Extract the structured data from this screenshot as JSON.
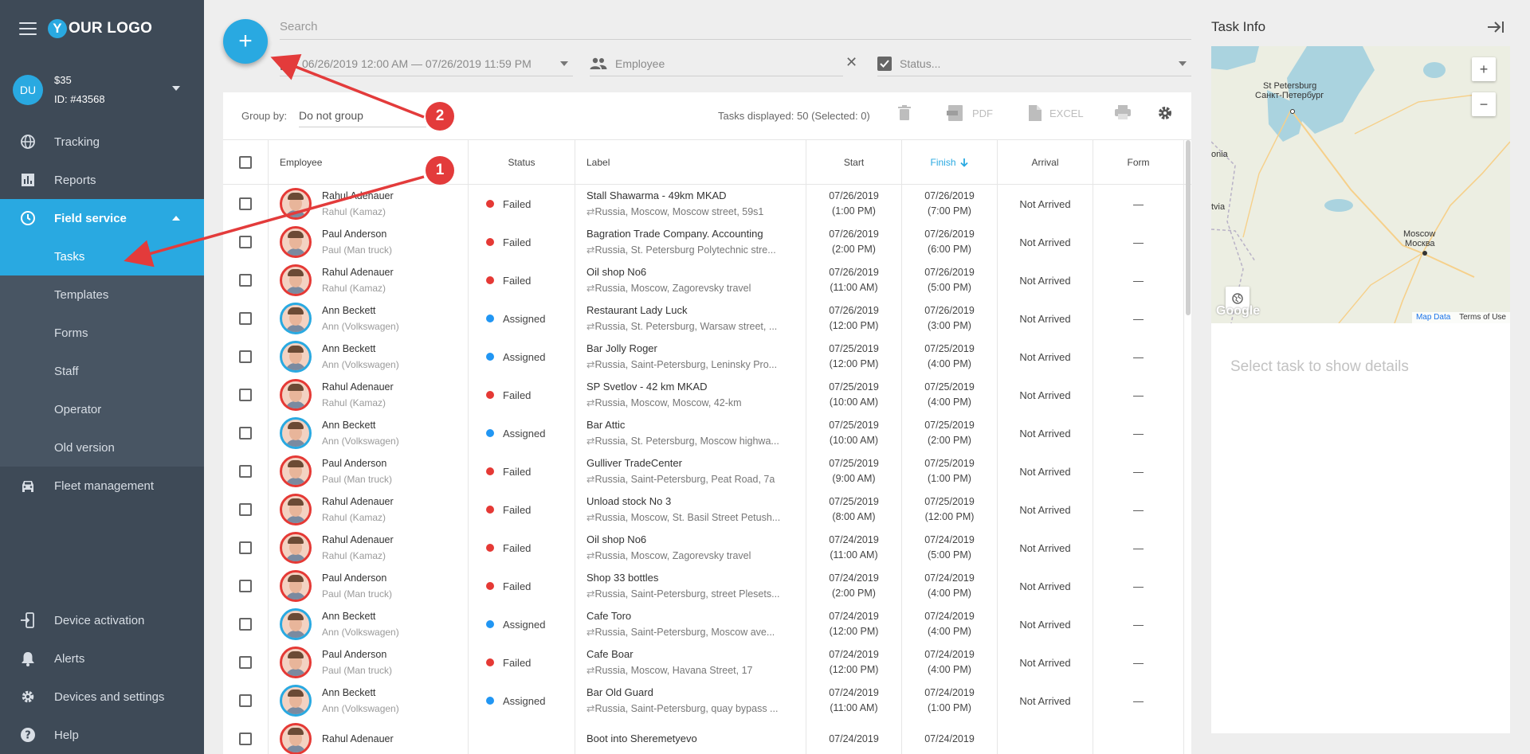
{
  "sidebar": {
    "logo_y": "Y",
    "logo_text": "OUR LOGO",
    "user": {
      "initials": "DU",
      "balance": "$35",
      "id": "ID: #43568"
    },
    "nav_top": [
      {
        "label": "Tracking",
        "icon": "globe-icon"
      },
      {
        "label": "Reports",
        "icon": "bar-chart-icon"
      },
      {
        "label": "Field service",
        "icon": "clock-icon",
        "active": true
      }
    ],
    "subnav": [
      {
        "label": "Tasks",
        "active": true
      },
      {
        "label": "Templates"
      },
      {
        "label": "Forms"
      },
      {
        "label": "Staff"
      },
      {
        "label": "Operator"
      },
      {
        "label": "Old version"
      }
    ],
    "fleet": {
      "label": "Fleet management",
      "icon": "car-icon"
    },
    "nav_bottom": [
      {
        "label": "Device activation",
        "icon": "device-login-icon"
      },
      {
        "label": "Alerts",
        "icon": "bell-icon"
      },
      {
        "label": "Devices and settings",
        "icon": "gear-icon"
      },
      {
        "label": "Help",
        "icon": "help-icon"
      }
    ]
  },
  "toolbar": {
    "fab_label": "+",
    "search_placeholder": "Search",
    "date_range": "06/26/2019 12:00 AM — 07/26/2019 11:59 PM",
    "employee_placeholder": "Employee",
    "clear_label": "✕",
    "status_placeholder": "Status..."
  },
  "table_toolbar": {
    "group_by_label": "Group by:",
    "group_by_value": "Do not group",
    "tasks_count": "Tasks displayed: 50 (Selected: 0)",
    "pdf_label": "PDF",
    "excel_label": "EXCEL"
  },
  "columns": {
    "employee": "Employee",
    "status": "Status",
    "label": "Label",
    "start": "Start",
    "finish": "Finish",
    "arrival": "Arrival",
    "form": "Form"
  },
  "status_colors": {
    "Failed": "#e53935",
    "Assigned": "#2196f3"
  },
  "rows": [
    {
      "name": "Rahul Adenauer",
      "sub": "Rahul (Kamaz)",
      "avatar": "red",
      "status": "Failed",
      "title": "Stall Shawarma - 49km MKAD",
      "addr": "Russia, Moscow, Moscow street, 59s1",
      "start_date": "07/26/2019",
      "start_time": "(1:00 PM)",
      "finish_date": "07/26/2019",
      "finish_time": "(7:00 PM)",
      "arrival": "Not Arrived",
      "form": "—"
    },
    {
      "name": "Paul Anderson",
      "sub": "Paul (Man truck)",
      "avatar": "red",
      "status": "Failed",
      "title": "Bagration Trade Company. Accounting",
      "addr": "Russia, St. Petersburg Polytechnic stre...",
      "start_date": "07/26/2019",
      "start_time": "(2:00 PM)",
      "finish_date": "07/26/2019",
      "finish_time": "(6:00 PM)",
      "arrival": "Not Arrived",
      "form": "—"
    },
    {
      "name": "Rahul Adenauer",
      "sub": "Rahul (Kamaz)",
      "avatar": "red",
      "status": "Failed",
      "title": "Oil shop No6",
      "addr": "Russia, Moscow, Zagorevsky travel",
      "start_date": "07/26/2019",
      "start_time": "(11:00 AM)",
      "finish_date": "07/26/2019",
      "finish_time": "(5:00 PM)",
      "arrival": "Not Arrived",
      "form": "—"
    },
    {
      "name": "Ann Beckett",
      "sub": "Ann (Volkswagen)",
      "avatar": "blue",
      "status": "Assigned",
      "title": "Restaurant Lady Luck",
      "addr": "Russia, St. Petersburg, Warsaw street, ...",
      "start_date": "07/26/2019",
      "start_time": "(12:00 PM)",
      "finish_date": "07/26/2019",
      "finish_time": "(3:00 PM)",
      "arrival": "Not Arrived",
      "form": "—"
    },
    {
      "name": "Ann Beckett",
      "sub": "Ann (Volkswagen)",
      "avatar": "blue",
      "status": "Assigned",
      "title": "Bar Jolly Roger",
      "addr": "Russia, Saint-Petersburg, Leninsky Pro...",
      "start_date": "07/25/2019",
      "start_time": "(12:00 PM)",
      "finish_date": "07/25/2019",
      "finish_time": "(4:00 PM)",
      "arrival": "Not Arrived",
      "form": "—"
    },
    {
      "name": "Rahul Adenauer",
      "sub": "Rahul (Kamaz)",
      "avatar": "red",
      "status": "Failed",
      "title": "SP Svetlov - 42 km MKAD",
      "addr": "Russia, Moscow, Moscow, 42-km",
      "start_date": "07/25/2019",
      "start_time": "(10:00 AM)",
      "finish_date": "07/25/2019",
      "finish_time": "(4:00 PM)",
      "arrival": "Not Arrived",
      "form": "—"
    },
    {
      "name": "Ann Beckett",
      "sub": "Ann (Volkswagen)",
      "avatar": "blue",
      "status": "Assigned",
      "title": "Bar Attic",
      "addr": "Russia, St. Petersburg, Moscow highwa...",
      "start_date": "07/25/2019",
      "start_time": "(10:00 AM)",
      "finish_date": "07/25/2019",
      "finish_time": "(2:00 PM)",
      "arrival": "Not Arrived",
      "form": "—"
    },
    {
      "name": "Paul Anderson",
      "sub": "Paul (Man truck)",
      "avatar": "red",
      "status": "Failed",
      "title": "Gulliver TradeCenter",
      "addr": "Russia, Saint-Petersburg, Peat Road, 7a",
      "start_date": "07/25/2019",
      "start_time": "(9:00 AM)",
      "finish_date": "07/25/2019",
      "finish_time": "(1:00 PM)",
      "arrival": "Not Arrived",
      "form": "—"
    },
    {
      "name": "Rahul Adenauer",
      "sub": "Rahul (Kamaz)",
      "avatar": "red",
      "status": "Failed",
      "title": "Unload stock No 3",
      "addr": "Russia, Moscow, St. Basil Street Petush...",
      "start_date": "07/25/2019",
      "start_time": "(8:00 AM)",
      "finish_date": "07/25/2019",
      "finish_time": "(12:00 PM)",
      "arrival": "Not Arrived",
      "form": "—"
    },
    {
      "name": "Rahul Adenauer",
      "sub": "Rahul (Kamaz)",
      "avatar": "red",
      "status": "Failed",
      "title": "Oil shop No6",
      "addr": "Russia, Moscow, Zagorevsky travel",
      "start_date": "07/24/2019",
      "start_time": "(11:00 AM)",
      "finish_date": "07/24/2019",
      "finish_time": "(5:00 PM)",
      "arrival": "Not Arrived",
      "form": "—"
    },
    {
      "name": "Paul Anderson",
      "sub": "Paul (Man truck)",
      "avatar": "red",
      "status": "Failed",
      "title": "Shop 33 bottles",
      "addr": "Russia, Saint-Petersburg, street Plesets...",
      "start_date": "07/24/2019",
      "start_time": "(2:00 PM)",
      "finish_date": "07/24/2019",
      "finish_time": "(4:00 PM)",
      "arrival": "Not Arrived",
      "form": "—"
    },
    {
      "name": "Ann Beckett",
      "sub": "Ann (Volkswagen)",
      "avatar": "blue",
      "status": "Assigned",
      "title": "Cafe Toro",
      "addr": "Russia, Saint-Petersburg, Moscow ave...",
      "start_date": "07/24/2019",
      "start_time": "(12:00 PM)",
      "finish_date": "07/24/2019",
      "finish_time": "(4:00 PM)",
      "arrival": "Not Arrived",
      "form": "—"
    },
    {
      "name": "Paul Anderson",
      "sub": "Paul (Man truck)",
      "avatar": "red",
      "status": "Failed",
      "title": "Cafe Boar",
      "addr": "Russia, Moscow, Havana Street, 17",
      "start_date": "07/24/2019",
      "start_time": "(12:00 PM)",
      "finish_date": "07/24/2019",
      "finish_time": "(4:00 PM)",
      "arrival": "Not Arrived",
      "form": "—"
    },
    {
      "name": "Ann Beckett",
      "sub": "Ann (Volkswagen)",
      "avatar": "blue",
      "status": "Assigned",
      "title": "Bar Old Guard",
      "addr": "Russia, Saint-Petersburg, quay bypass ...",
      "start_date": "07/24/2019",
      "start_time": "(11:00 AM)",
      "finish_date": "07/24/2019",
      "finish_time": "(1:00 PM)",
      "arrival": "Not Arrived",
      "form": "—"
    },
    {
      "name": "Rahul Adenauer",
      "sub": "",
      "avatar": "red",
      "status": "",
      "title": "Boot into Sheremetyevo",
      "addr": "",
      "start_date": "07/24/2019",
      "start_time": "",
      "finish_date": "07/24/2019",
      "finish_time": "",
      "arrival": "",
      "form": ""
    }
  ],
  "panel": {
    "title": "Task Info",
    "zoom_in": "+",
    "zoom_out": "−",
    "map_labels": [
      "St Petersburg",
      "Санкт-Петербург",
      "onia",
      "tvia",
      "Moscow",
      "Москва"
    ],
    "map_attribution_google": "Google",
    "map_data": "Map Data",
    "map_terms": "Terms of Use",
    "details_placeholder": "Select task to show details"
  },
  "annotations": {
    "badge1": "1",
    "badge2": "2",
    "color": "#e33b3b"
  }
}
